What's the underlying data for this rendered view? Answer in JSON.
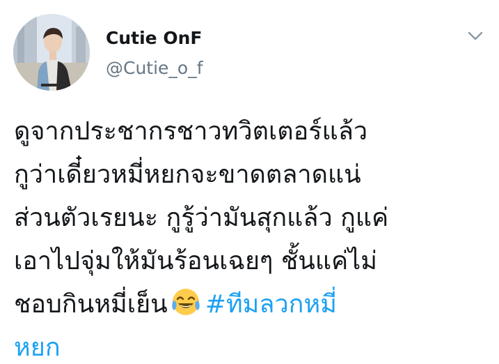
{
  "tweet": {
    "author": {
      "display_name": "Cutie OnF",
      "handle": "@Cutie_o_f",
      "avatar_icon": "profile-photo"
    },
    "menu_icon": "chevron-down-icon",
    "text_lines": [
      "ดูจากประชากรชาวทวิตเตอร์แล้ว",
      "กูว่าเดี๋ยวหมี่หยกจะขาดตลาดแน่",
      "ส่วนตัวเรยนะ กูรู้ว่ามันสุกแล้ว กูแค่",
      "เอาไปจุ่มให้มันร้อนเฉยๆ ชั้นแค่ไม่",
      "ชอบกินหมี่เย็น"
    ],
    "emoji": "face-with-tears-of-joy",
    "hashtag_part1": "#ทีมลวกหมี่",
    "hashtag_part2": "หยก",
    "colors": {
      "text": "#14171a",
      "secondary": "#657786",
      "link": "#1da1f2"
    }
  }
}
